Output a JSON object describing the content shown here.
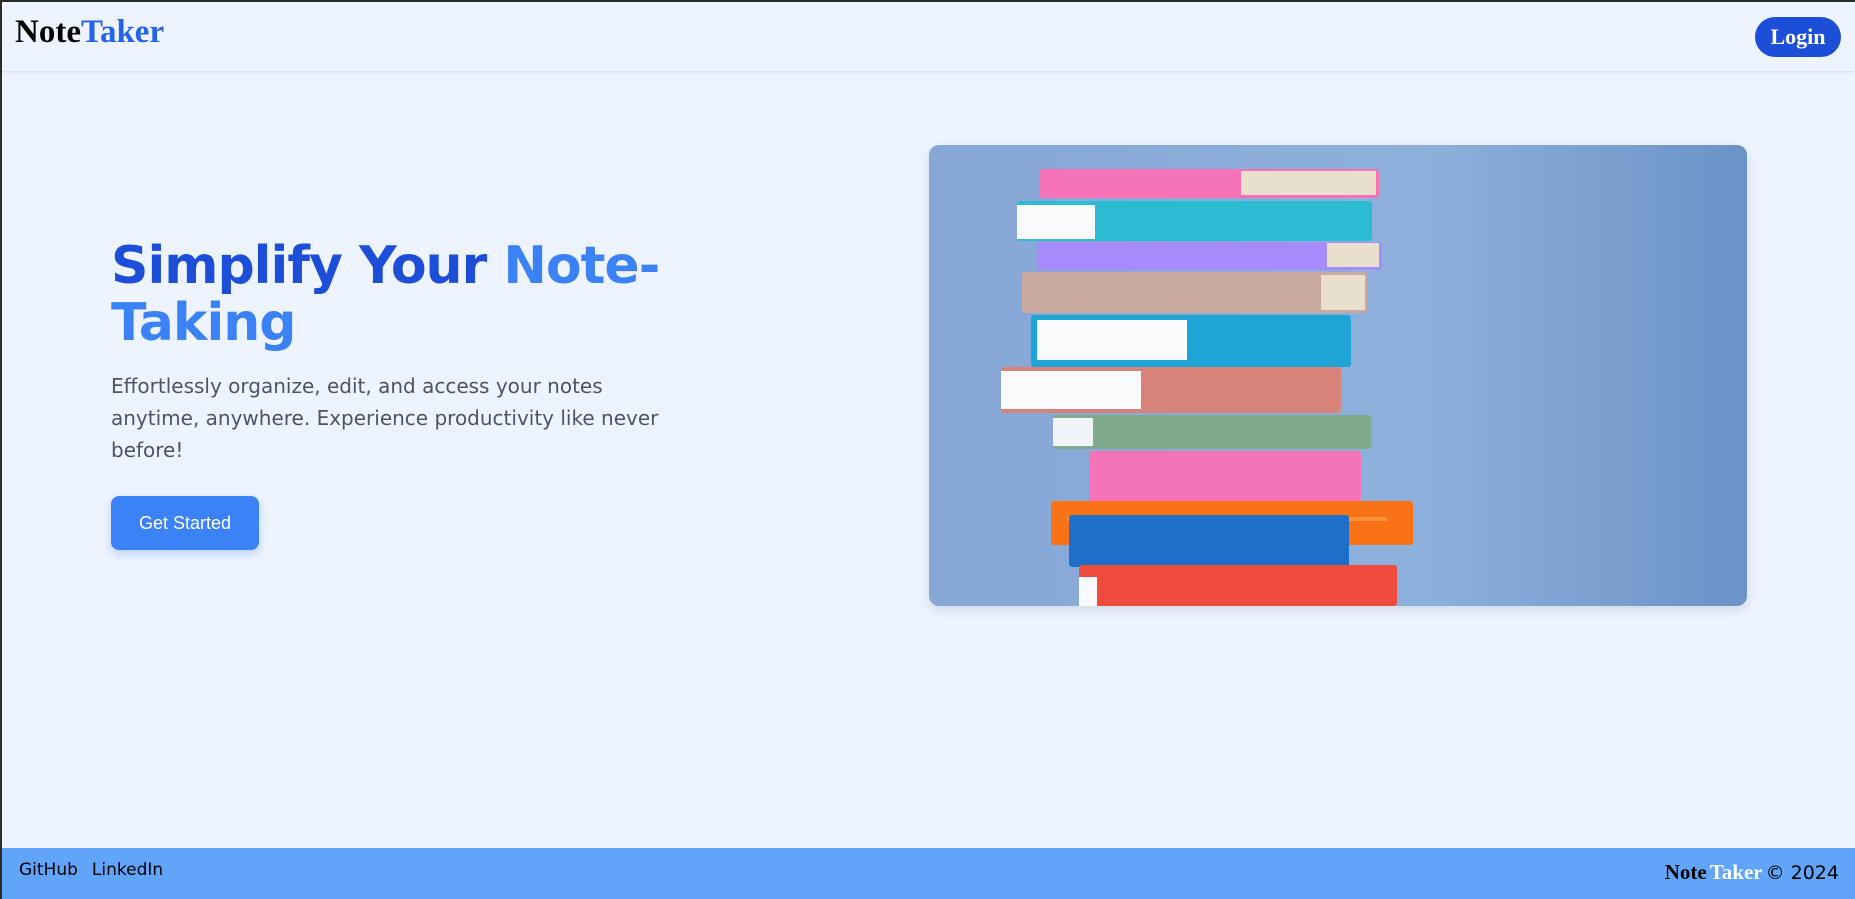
{
  "header": {
    "logo_part1": "Note",
    "logo_part2": "Taker",
    "login_label": "Login"
  },
  "hero": {
    "title_part1": "Simplify Your ",
    "title_part2": "Note-Taking",
    "subtitle": "Effortlessly organize, edit, and access your notes anytime, anywhere. Experience productivity like never before!",
    "cta_label": "Get Started"
  },
  "footer": {
    "links": [
      "GitHub",
      "LinkedIn"
    ],
    "brand_part1": "Note",
    "brand_part2": "Taker",
    "copyright": "© 2024"
  },
  "colors": {
    "accent": "#1d4ed8",
    "accent_light": "#3b82f6",
    "background": "#eef4ff",
    "footer": "#60a5fa"
  }
}
